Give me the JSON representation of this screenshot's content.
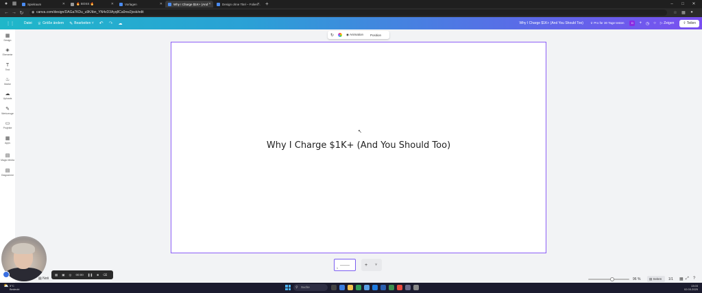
{
  "browser": {
    "tabs": [
      {
        "label": "Spielraum"
      },
      {
        "label": "🔥 BOSS 🔥"
      },
      {
        "label": "Vorlagen"
      },
      {
        "label": "Why I Charge $1K+ (And"
      },
      {
        "label": "Design ohne Titel – Folien..."
      }
    ],
    "url": "canva.com/design/DAGa7KDu_u9K/ibn_YN4vD3Ayq8Ca0nw2jxsk/edit"
  },
  "canva_toolbar": {
    "file": "Datei",
    "resize": "Größe ändern",
    "edit": "Bearbeiten",
    "doc_title": "Why I Charge $1K+ (And You Should Too)",
    "pro_offer": "Pro für 30 Tage testen",
    "avatar_letter": "D",
    "present": "Zeigen",
    "share": "Teilen"
  },
  "sidebar": {
    "items": [
      {
        "label": "Design",
        "icon": "layout-icon"
      },
      {
        "label": "Elemente",
        "icon": "shapes-icon"
      },
      {
        "label": "Text",
        "icon": "text-icon"
      },
      {
        "label": "Marke",
        "icon": "brand-icon"
      },
      {
        "label": "Uploads",
        "icon": "upload-icon"
      },
      {
        "label": "Werkzeuge",
        "icon": "draw-icon"
      },
      {
        "label": "Projekte",
        "icon": "folder-icon"
      },
      {
        "label": "Apps",
        "icon": "apps-icon"
      },
      {
        "label": "Magic Media",
        "icon": "magic-media-icon"
      },
      {
        "label": "Diagramme",
        "icon": "chart-icon"
      }
    ]
  },
  "context_toolbar": {
    "animation": "Animation",
    "position": "Position"
  },
  "canvas": {
    "title": "Why I Charge $1K+ (And You Should Too)"
  },
  "pages": {
    "thumb_number": "1",
    "add": "+"
  },
  "recorder": {
    "time": "00:00"
  },
  "notes": {
    "label": "Noti"
  },
  "status": {
    "zoom": "96 %",
    "pages_button": "Seiten",
    "page_count": "1/1"
  },
  "taskbar": {
    "weather_temp": "5°C",
    "weather_desc": "Bedeckt",
    "search": "Suche",
    "time": "13:03",
    "date": "02.03.2025"
  }
}
